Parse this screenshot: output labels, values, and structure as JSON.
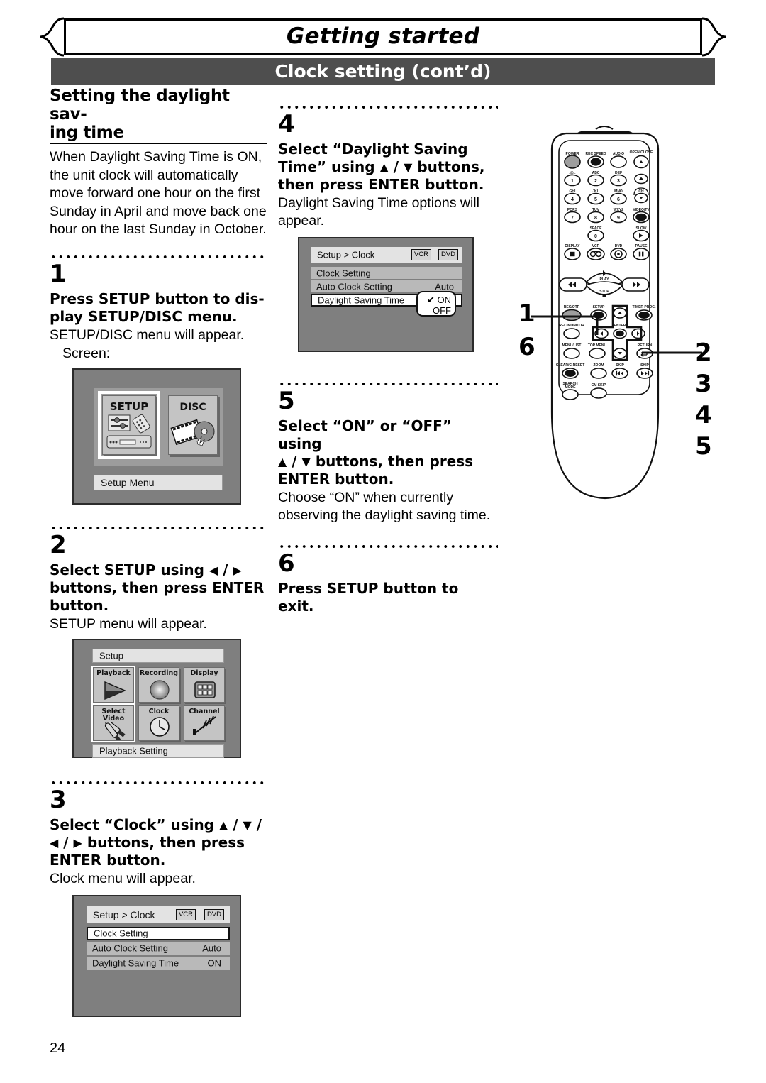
{
  "header": {
    "title": "Getting started",
    "subtitle": "Clock setting (cont’d)"
  },
  "left_column": {
    "section_title": "Setting the daylight sav- ing time",
    "intro": "When Daylight Saving Time is ON, the unit clock will automatically move forward one hour on the first Sunday in April and move back one hour on the last Sunday in October.",
    "steps": [
      {
        "num": "1",
        "bold": "Press SETUP button to display SETUP/DISC menu.",
        "sub": "SETUP/DISC menu will appear.",
        "sub2": "Screen:"
      },
      {
        "num": "2",
        "bold": "Select SETUP using ◀ / ▶ buttons, then press ENTER button.",
        "sub": "SETUP menu will appear."
      },
      {
        "num": "3",
        "bold": "Select “Clock” using ▲ / ▼ / ◀ / ▶ buttons, then press ENTER button.",
        "sub": "Clock menu will appear."
      }
    ]
  },
  "mid_column": {
    "steps": [
      {
        "num": "4",
        "bold": "Select “Daylight Saving Time” using ▲ / ▼ buttons, then press ENTER button.",
        "sub": "Daylight Saving Time options will appear."
      },
      {
        "num": "5",
        "bold": "Select “ON” or “OFF” using ▲ / ▼ buttons, then press ENTER button.",
        "sub": "Choose “ON” when currently observing the daylight saving time."
      },
      {
        "num": "6",
        "bold": "Press SETUP button to exit.",
        "sub": ""
      }
    ]
  },
  "screens": {
    "setup_disc": {
      "tile_setup": "SETUP",
      "tile_disc": "DISC",
      "footer": "Setup Menu"
    },
    "setup_menu": {
      "header": "Setup",
      "tiles": [
        "Playback",
        "Recording",
        "Display",
        "Select Video",
        "Clock",
        "Channel"
      ],
      "tiles_line1": [
        "Playback",
        "Recording",
        "Display",
        "Select",
        "Clock",
        "Channel"
      ],
      "tiles_line2": [
        "",
        "",
        "",
        "Video",
        "",
        ""
      ],
      "footer": "Playback Setting"
    },
    "clock_menu": {
      "title": "Setup > Clock",
      "badge_vcr": "VCR",
      "badge_dvd": "DVD",
      "rows": [
        {
          "label": "Clock Setting",
          "value": "",
          "selected": true
        },
        {
          "label": "Auto Clock Setting",
          "value": "Auto",
          "selected": false
        },
        {
          "label": "Daylight Saving Time",
          "value": "ON",
          "selected": false
        }
      ]
    },
    "clock_menu_dst": {
      "title": "Setup > Clock",
      "badge_vcr": "VCR",
      "badge_dvd": "DVD",
      "rows": [
        {
          "label": "Clock Setting",
          "value": "",
          "selected": false
        },
        {
          "label": "Auto Clock Setting",
          "value": "Auto",
          "selected": false
        },
        {
          "label": "Daylight Saving Time",
          "value": "",
          "selected": true
        }
      ],
      "popup": {
        "on": "✔ ON",
        "off": "OFF"
      }
    }
  },
  "remote": {
    "labels": {
      "power": "POWER",
      "rec_speed": "REC SPEED",
      "audio": "AUDIO",
      "open_close": "OPEN/CLOSE",
      "k1": ".@/:",
      "k2": "ABC",
      "k3": "DEF",
      "k4": "GHI",
      "k5": "JKL",
      "k6": "MNO",
      "k7": "PQRS",
      "k8": "TUV",
      "k9": "WXYZ",
      "k0": "SPACE",
      "ch": "CH",
      "video_tv": "VIDEO/TV",
      "slow": "SLOW",
      "display": "DISPLAY",
      "vcr": "VCR",
      "dvd": "DVD",
      "pause": "PAUSE",
      "play": "PLAY",
      "stop": "STOP",
      "rec_otr": "REC/OTR",
      "setup": "SETUP",
      "timer_prog": "TIMER PROG.",
      "rec_monitor": "REC MONITOR",
      "enter": "ENTER",
      "menu_list": "MENU/LIST",
      "top_menu": "TOP MENU",
      "return": "RETURN",
      "clear_c_reset": "CLEAR/C-RESET",
      "zoom": "ZOOM",
      "skip_back": "SKIP",
      "skip_fwd": "SKIP",
      "search_mode": "SEARCH MODE",
      "cm_skip": "CM SKIP",
      "num1": "1",
      "num2": "2",
      "num3": "3",
      "num4": "4",
      "num5": "5",
      "num6": "6",
      "num7": "7",
      "num8": "8",
      "num9": "9",
      "num0": "0"
    }
  },
  "callouts": {
    "left_top": "1",
    "left_bottom": "6",
    "right": [
      "2",
      "3",
      "4",
      "5"
    ]
  },
  "page_number": "24",
  "colors": {
    "banner_bg": "#4e4e4e",
    "banner_text": "#ffffff",
    "screen_bg": "#7f7f7f",
    "row_bg": "#b9b9b9",
    "ink": "#000000"
  }
}
